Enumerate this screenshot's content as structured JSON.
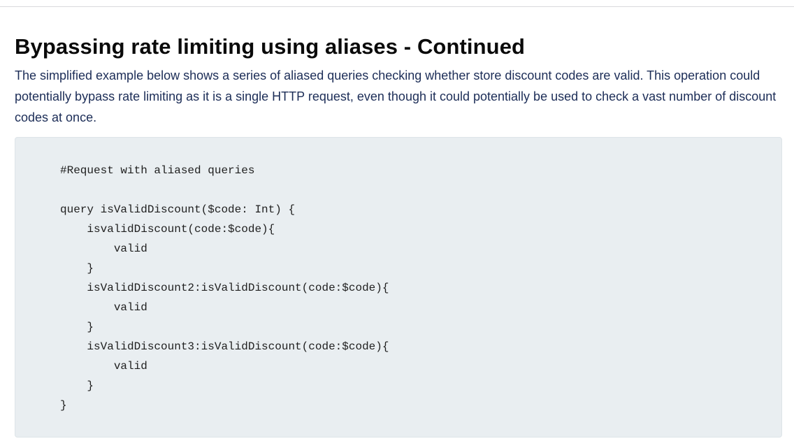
{
  "heading": "Bypassing rate limiting using aliases - Continued",
  "paragraph": "The simplified example below shows a series of aliased queries checking whether store discount codes are valid. This operation could potentially bypass rate limiting as it is a single HTTP request, even though it could potentially be used to check a vast number of discount codes at once.",
  "code": "#Request with aliased queries\n\nquery isValidDiscount($code: Int) {\n    isvalidDiscount(code:$code){\n        valid\n    }\n    isValidDiscount2:isValidDiscount(code:$code){\n        valid\n    }\n    isValidDiscount3:isValidDiscount(code:$code){\n        valid\n    }\n}"
}
